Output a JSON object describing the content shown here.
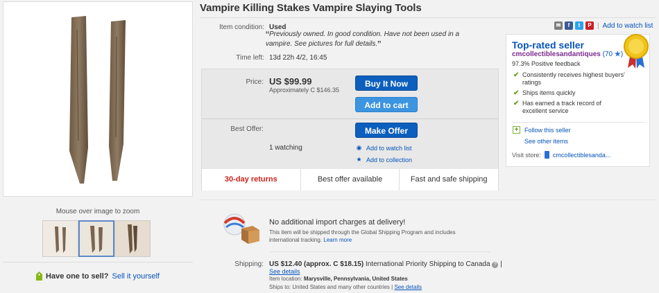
{
  "gallery": {
    "zoom_hint": "Mouse over image to zoom",
    "sell_question": "Have one to sell?",
    "sell_link": "Sell it yourself"
  },
  "item": {
    "title": "Vampire Killing Stakes Vampire Slaying Tools",
    "condition_label": "Item condition:",
    "condition_value": "Used",
    "condition_desc": "Previously owned. In good condition. Have not been used in a vampire. See pictures for full details.",
    "time_left_label": "Time left:",
    "time_left_value": "13d 22h 4/2, 16:45"
  },
  "price": {
    "label": "Price:",
    "value": "US $99.99",
    "approx": "Approximately C $146.35",
    "buy_now": "Buy It Now",
    "add_to_cart": "Add to cart",
    "best_offer_label": "Best Offer:",
    "make_offer": "Make Offer",
    "watching": "1 watching",
    "add_watch": "Add to watch list",
    "add_collection": "Add to collection"
  },
  "highlights": [
    "30-day returns",
    "Best offer available",
    "Fast and safe shipping"
  ],
  "share": {
    "sep": "|",
    "watch_link": "Add to watch list"
  },
  "seller": {
    "heading": "Top-rated seller",
    "name": "cmcollectiblesandantiques",
    "feedback_open": " (",
    "feedback_count": "70",
    "feedback_close": ")",
    "positive": "97.3% Positive feedback",
    "perks": [
      "Consistently receives highest buyers' ratings",
      "Ships items quickly",
      "Has earned a track record of excellent service"
    ],
    "follow": "Follow this seller",
    "other_items": "See other items",
    "visit_store_label": "Visit store:",
    "store_name": "cmcollectiblesanda..."
  },
  "shipping": {
    "gsp_title": "No additional import charges at delivery!",
    "gsp_desc": "This item will be shipped through the Global Shipping Program and includes international tracking.",
    "gsp_learn_more": "Learn more",
    "label": "Shipping:",
    "cost": "US $12.40 (approx. C $18.15)",
    "service": "International Priority Shipping to Canada",
    "sep": "|",
    "see_details": "See details",
    "location_label": "Item location:",
    "location_value": "Marysville, Pennsylvania, United States",
    "ships_to_label": "Ships to:",
    "ships_to_value": "United States and many other countries",
    "ships_to_sep": "|"
  },
  "colors": {
    "link": "#0654ba",
    "buy_button": "#0d5fbe",
    "cart_button": "#3d94e0",
    "returns_red": "#c9231a",
    "seller_name": "#7b2a8c",
    "check_green": "#6ba32e"
  }
}
